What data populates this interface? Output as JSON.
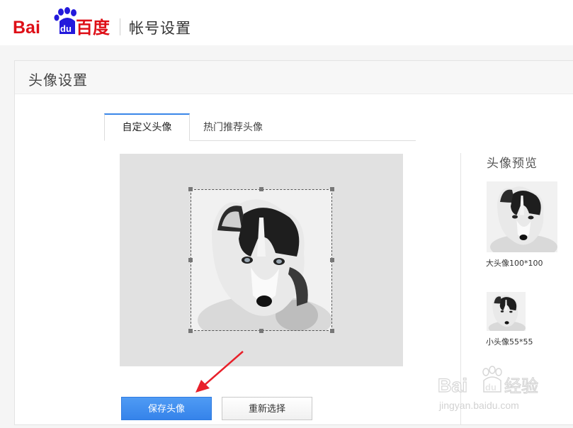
{
  "header": {
    "logo_text_left": "Bai",
    "logo_text_du": "du",
    "logo_text_cn": "百度",
    "title": "帐号设置"
  },
  "panel": {
    "title": "头像设置",
    "tabs": [
      {
        "label": "自定义头像",
        "active": true
      },
      {
        "label": "热门推荐头像",
        "active": false
      }
    ],
    "preview": {
      "title": "头像预览",
      "big_label": "大头像100*100",
      "small_label": "小头像55*55"
    },
    "buttons": {
      "save": "保存头像",
      "reselect": "重新选择"
    }
  },
  "watermark": {
    "brand": "Bai",
    "brand_du": "du",
    "brand_cn": "经验",
    "url": "jingyan.baidu.com"
  },
  "colors": {
    "accent": "#3583ea",
    "brand_red": "#de0f17",
    "brand_blue": "#2319dc",
    "annotation_arrow": "#e8202a"
  }
}
